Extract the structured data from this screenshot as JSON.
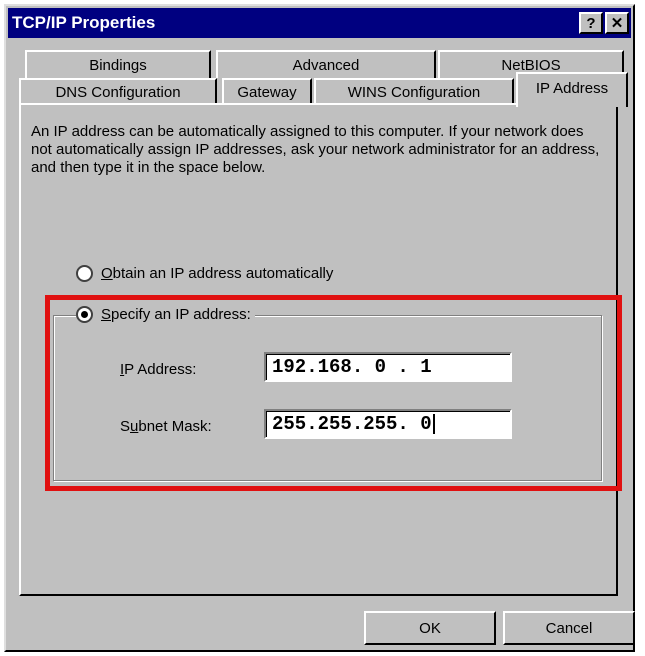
{
  "window": {
    "title": "TCP/IP Properties",
    "help_label": "?",
    "close_label": "✕"
  },
  "tabs": {
    "row1": [
      "Bindings",
      "Advanced",
      "NetBIOS"
    ],
    "row2": [
      "DNS Configuration",
      "Gateway",
      "WINS Configuration",
      "IP Address"
    ],
    "active": "IP Address"
  },
  "description": "An IP address can be automatically assigned to this computer. If your network does not automatically assign IP addresses, ask your network administrator for an address, and then type it in the space below.",
  "options": {
    "obtain": {
      "underline": "O",
      "rest": "btain an IP address automatically",
      "checked": false
    },
    "specify": {
      "underline": "S",
      "rest": "pecify an IP address:",
      "checked": true
    }
  },
  "fields": {
    "ip_label": {
      "underline": "I",
      "rest": "P Address:"
    },
    "ip_value": "192.168. 0 . 1",
    "mask_label": {
      "pre": "S",
      "underline": "u",
      "rest": "bnet Mask:"
    },
    "mask_value": "255.255.255. 0"
  },
  "buttons": {
    "ok": "OK",
    "cancel": "Cancel"
  },
  "colors": {
    "titlebar": "#000080",
    "highlight": "#e01010",
    "face": "#c0c0c0"
  }
}
